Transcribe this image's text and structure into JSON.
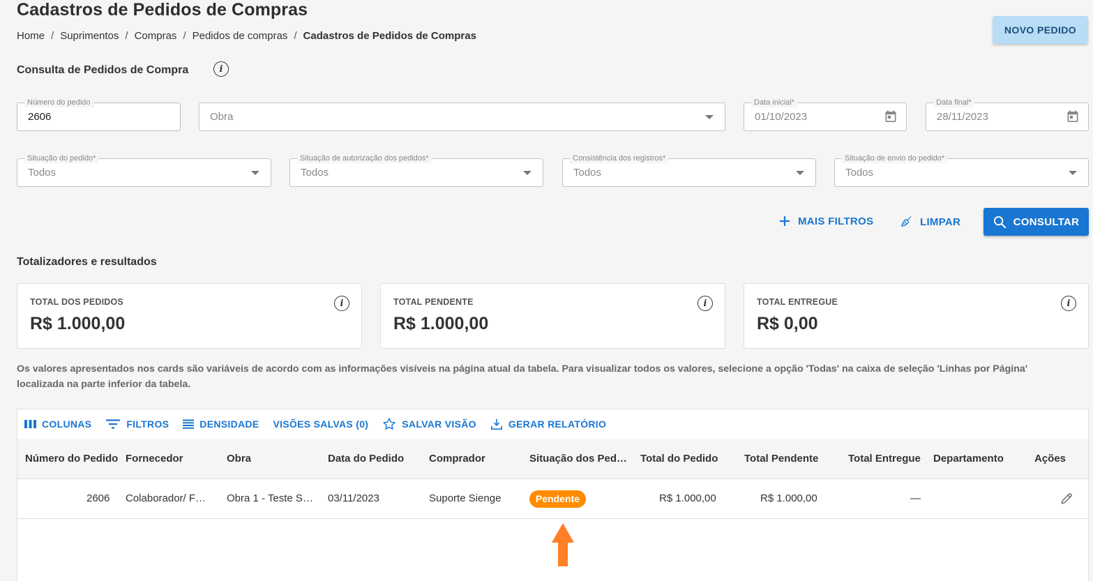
{
  "page": {
    "title": "Cadastros de Pedidos de Compras",
    "breadcrumb": [
      "Home",
      "Suprimentos",
      "Compras",
      "Pedidos de compras",
      "Cadastros de Pedidos de Compras"
    ],
    "breadcrumb_sep": "/",
    "new_button": "NOVO PEDIDO"
  },
  "search": {
    "title": "Consulta de Pedidos de Compra",
    "order_number": {
      "label": "Número do pedido",
      "value": "2606"
    },
    "obra": {
      "placeholder": "Obra"
    },
    "start_date": {
      "label": "Data inicial*",
      "value": "01/10/2023"
    },
    "end_date": {
      "label": "Data final*",
      "value": "28/11/2023"
    },
    "order_status": {
      "label": "Situação do pedido*",
      "value": "Todos"
    },
    "auth_status": {
      "label": "Situação de autorização dos pedidos*",
      "value": "Todos"
    },
    "consistency": {
      "label": "Consistência dos registros*",
      "value": "Todos"
    },
    "send_status": {
      "label": "Situação de envio do pedido*",
      "value": "Todos"
    },
    "more_filters": "MAIS FILTROS",
    "clear": "LIMPAR",
    "submit": "CONSULTAR"
  },
  "totals": {
    "title": "Totalizadores e resultados",
    "cards": [
      {
        "label": "TOTAL DOS PEDIDOS",
        "value": "R$ 1.000,00"
      },
      {
        "label": "TOTAL PENDENTE",
        "value": "R$ 1.000,00"
      },
      {
        "label": "TOTAL ENTREGUE",
        "value": "R$ 0,00"
      }
    ],
    "note": "Os valores apresentados nos cards são variáveis de acordo com as informações visíveis na página atual da tabela. Para visualizar todos os valores, selecione a opção 'Todas' na caixa de seleção 'Linhas por Página' localizada na parte inferior da tabela."
  },
  "table": {
    "toolbar": {
      "columns": "COLUNAS",
      "filters": "FILTROS",
      "density": "DENSIDADE",
      "saved_views": "VISÕES SALVAS (0)",
      "save_view": "SALVAR VISÃO",
      "report": "GERAR RELATÓRIO"
    },
    "headers": [
      "Número do Pedido",
      "Fornecedor",
      "Obra",
      "Data do Pedido",
      "Comprador",
      "Situação dos Ped…",
      "Total do Pedido",
      "Total Pendente",
      "Total Entregue",
      "Departamento",
      "Ações"
    ],
    "rows": [
      {
        "number": "2606",
        "supplier": "Colaborador/ F…",
        "obra": "Obra 1 - Teste S…",
        "date": "03/11/2023",
        "buyer": "Suporte Sienge",
        "status": "Pendente",
        "total": "R$ 1.000,00",
        "pending": "R$ 1.000,00",
        "delivered": "—",
        "department": ""
      }
    ]
  },
  "colors": {
    "primary": "#1976d2",
    "status_pending": "#ff8c00",
    "new_button_bg": "#b9dcf7",
    "arrow": "#ff7f27"
  }
}
